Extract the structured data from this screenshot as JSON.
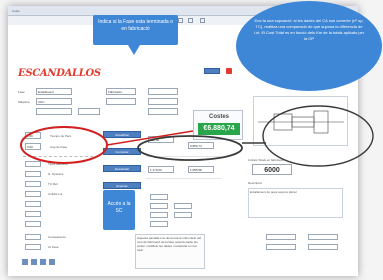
{
  "app": {
    "title": "ESCANDALLOS",
    "title_small": "Costs",
    "accent": "#e23a2e"
  },
  "callouts": {
    "top": "Indica si la Fase esta terminada o en fabricació",
    "right": "Ens fa una suposició: si les dades del CA son correcte (nº op, TC), realitza una comparació de que suposa la diferencia de l.ot. El Cost Total es en funció dels Km de la totals aplicats per la OP",
    "left_box": "Accés a la SC"
  },
  "form": {
    "field1_label": "Fase",
    "field1_value": "Entallament",
    "field2_label": "Màquina",
    "field2_value": "CNC",
    "field3_label": "Tipus",
    "field3_value": "Fabricació",
    "lot_label": "Lot",
    "lot_value": "6000"
  },
  "costs": {
    "title": "Costes",
    "total": "€6.880,74",
    "total_color": "#29a64a"
  },
  "left": {
    "input1": "2,00",
    "input2": "3,00",
    "rows": [
      "Tiempo de Paro",
      "Cap de Fase",
      "Tipus Màquina",
      "N. Operaris",
      "TC Ref.",
      "Unitats Lot"
    ],
    "bottom_inputs": [
      "Conseqüents",
      "Ut Fase"
    ]
  },
  "mid": {
    "blue_buttons": [
      "Actualitzar",
      "Comparar",
      "Recalcular",
      "Exportar"
    ],
    "values": [
      "102,00",
      "6.880,74",
      "1.170,00",
      "1.085,58"
    ],
    "note": "Aquesta pantalla ens dona tota la informació del cost de fabricació de la fase seleccionada. Es poden modificar les dades i recalcular el cost total."
  },
  "right": {
    "fieldset_label": "Unitats Totals en fabricació",
    "lot_total": "6000",
    "desc_label": "Descripció",
    "desc_text": "Entallament de peça segons plànol"
  }
}
